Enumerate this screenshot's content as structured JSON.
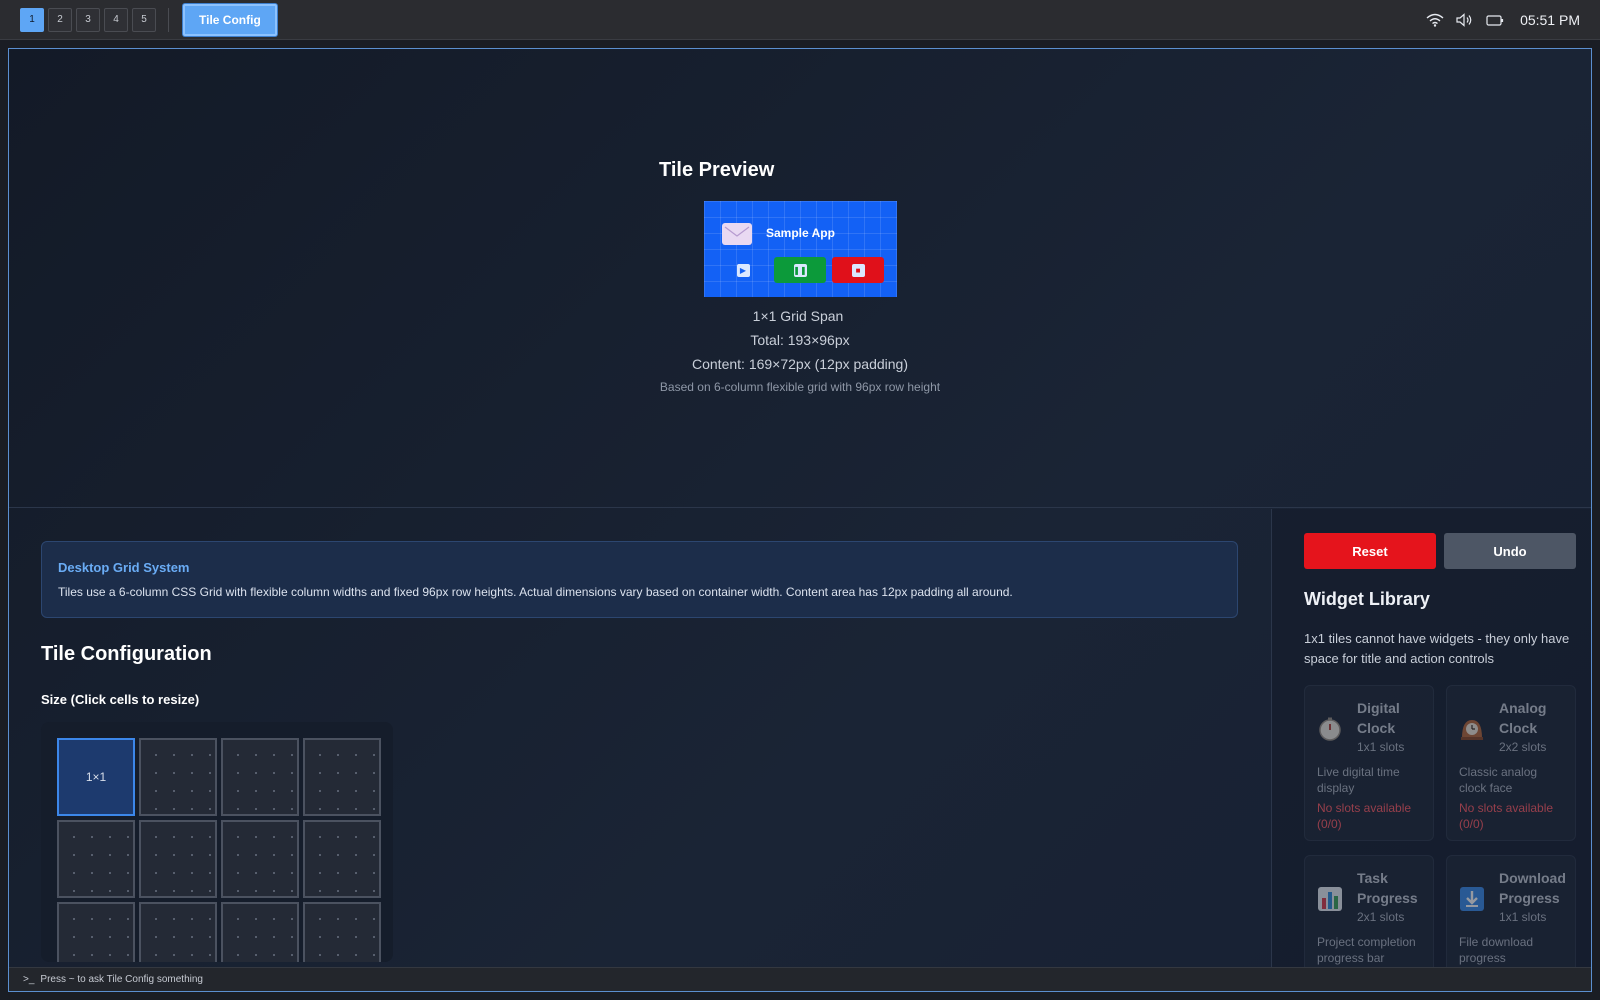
{
  "topbar": {
    "workspaces": [
      "1",
      "2",
      "3",
      "4",
      "5"
    ],
    "active_workspace": "1",
    "app_tab": "Tile Config",
    "time": "05:51 PM"
  },
  "preview": {
    "title": "Tile Preview",
    "tile_name": "Sample App",
    "grid_span": "1×1 Grid Span",
    "total": "Total: 193×96px",
    "content": "Content: 169×72px (12px padding)",
    "basis": "Based on 6-column flexible grid with 96px row height"
  },
  "grid_system": {
    "title": "Desktop Grid System",
    "text": "Tiles use a 6-column CSS Grid with flexible column widths and fixed 96px row heights. Actual dimensions vary based on container width. Content area has 12px padding all around."
  },
  "config": {
    "title": "Tile Configuration",
    "size_label": "Size (Click cells to resize)",
    "selected_cell_label": "1×1"
  },
  "actions": {
    "reset": "Reset",
    "undo": "Undo"
  },
  "widget_library": {
    "title": "Widget Library",
    "note": "1x1 tiles cannot have widgets - they only have space for title and action controls",
    "widgets": [
      {
        "name": "Digital Clock",
        "slots": "1x1 slots",
        "desc": "Live digital time display",
        "warn": "No slots available (0/0)"
      },
      {
        "name": "Analog Clock",
        "slots": "2x2 slots",
        "desc": "Classic analog clock face",
        "warn": "No slots available (0/0)"
      },
      {
        "name": "Task Progress",
        "slots": "2x1 slots",
        "desc": "Project completion progress bar",
        "warn": ""
      },
      {
        "name": "Download Progress",
        "slots": "1x1 slots",
        "desc": "File download progress",
        "warn": ""
      }
    ]
  },
  "statusbar": {
    "prompt": ">_",
    "hint": "Press ~ to ask Tile Config something"
  },
  "colors": {
    "accent": "#5ea6f5",
    "tile_bg": "#1361f5",
    "reset": "#e5141c",
    "warning": "#ff5a64"
  }
}
